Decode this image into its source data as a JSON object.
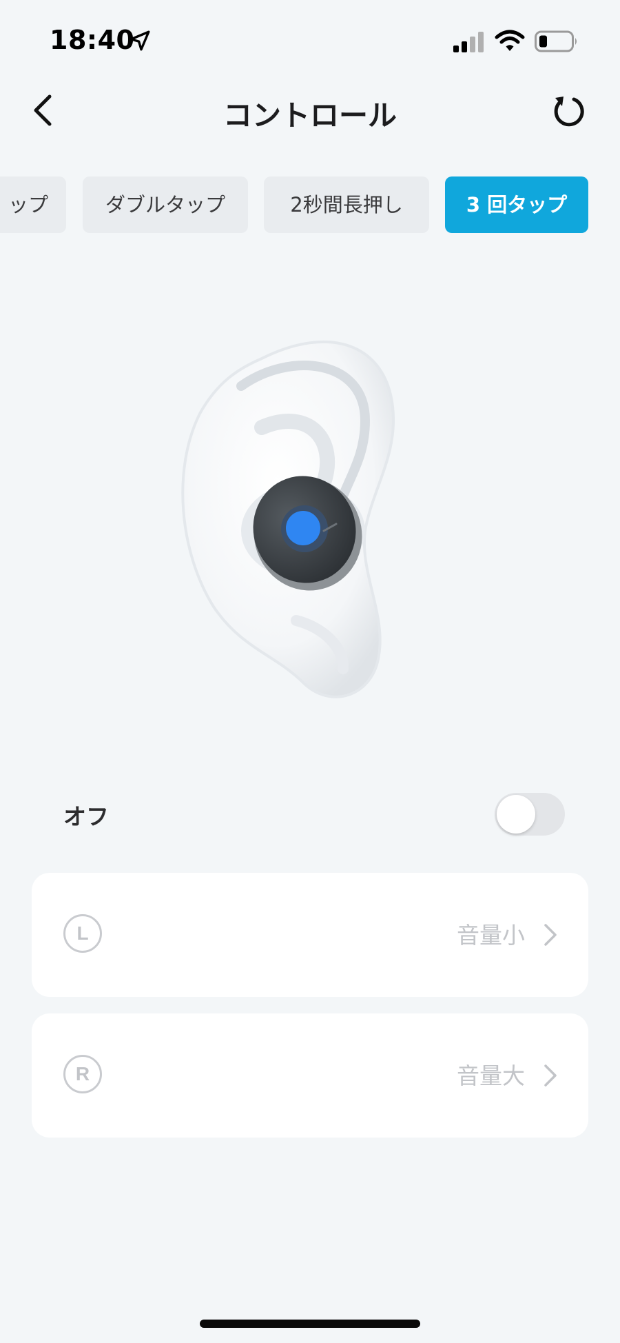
{
  "status_bar": {
    "time": "18:40",
    "icons": [
      "location-arrow-icon",
      "signal-icon",
      "wifi-icon",
      "battery-icon"
    ]
  },
  "header": {
    "title": "コントロール",
    "back_icon": "chevron-left-icon",
    "reset_icon": "reset-icon"
  },
  "tabs": [
    {
      "label": "タップ",
      "visible_text": "ップ",
      "active": false
    },
    {
      "label": "ダブルタップ",
      "active": false
    },
    {
      "label": "2秒間長押し",
      "active": false
    },
    {
      "label": "3 回タップ",
      "active": true
    }
  ],
  "illustration": {
    "description_icon": "earbud-in-ear-icon"
  },
  "toggle": {
    "label": "オフ",
    "on": false
  },
  "controls": [
    {
      "side": "L",
      "value": "音量小"
    },
    {
      "side": "R",
      "value": "音量大"
    }
  ],
  "colors": {
    "accent": "#10a7dc",
    "background": "#f3f6f8",
    "card": "#ffffff",
    "disabled_text": "#c2c4c8"
  }
}
